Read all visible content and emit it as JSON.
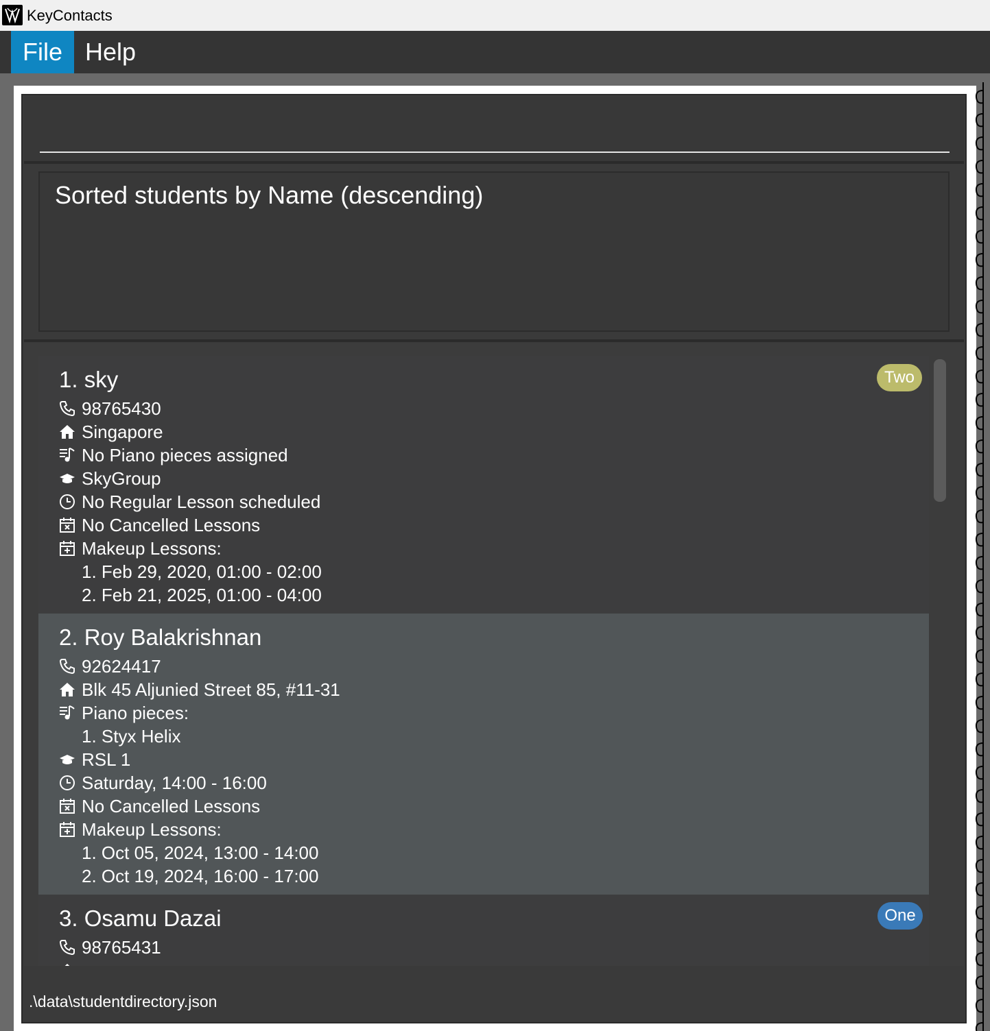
{
  "window": {
    "title": "KeyContacts"
  },
  "menu": {
    "file": "File",
    "help": "Help"
  },
  "command_box": {
    "value": "",
    "placeholder": ""
  },
  "result": {
    "message": "Sorted students by Name (descending)"
  },
  "students": [
    {
      "name": "1. sky",
      "tag": {
        "label": "Two",
        "color": "#bcbb6b"
      },
      "phone": "98765430",
      "address": "Singapore",
      "pieces_header": "No Piano pieces assigned",
      "pieces": [],
      "group": "SkyGroup",
      "regular_lesson": "No Regular Lesson scheduled",
      "cancelled": "No Cancelled Lessons",
      "makeup_header": "Makeup Lessons:",
      "makeup": [
        "1. Feb 29, 2020, 01:00 - 02:00",
        "2. Feb 21, 2025, 01:00 - 04:00"
      ]
    },
    {
      "name": "2. Roy Balakrishnan",
      "phone": "92624417",
      "address": "Blk 45 Aljunied Street 85, #11-31",
      "pieces_header": "Piano pieces:",
      "pieces": [
        "1. Styx Helix"
      ],
      "group": "RSL 1",
      "regular_lesson": "Saturday, 14:00 - 16:00",
      "cancelled": "No Cancelled Lessons",
      "makeup_header": "Makeup Lessons:",
      "makeup": [
        "1. Oct 05, 2024, 13:00 - 14:00",
        "2. Oct 19, 2024, 16:00 - 17:00"
      ]
    },
    {
      "name": "3. Osamu Dazai",
      "tag": {
        "label": "One",
        "color": "#3a7ab8"
      },
      "phone": "98765431"
    }
  ],
  "status": {
    "file_path": ".\\data\\studentdirectory.json"
  }
}
